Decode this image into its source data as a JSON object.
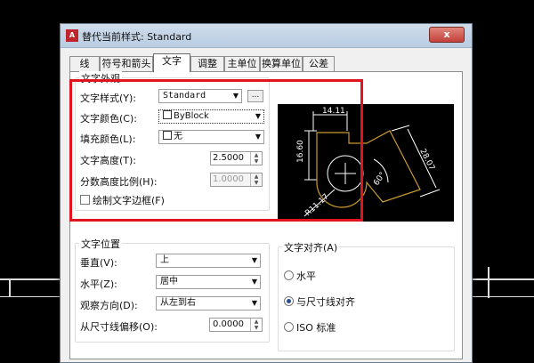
{
  "dialog": {
    "title": "替代当前样式: Standard",
    "app_icon_text": "A",
    "close_symbol": "x"
  },
  "tabs": [
    {
      "label": "线"
    },
    {
      "label": "符号和箭头"
    },
    {
      "label": "文字",
      "active": true
    },
    {
      "label": "调整"
    },
    {
      "label": "主单位"
    },
    {
      "label": "换算单位"
    },
    {
      "label": "公差"
    }
  ],
  "text_appearance": {
    "group_title": "文字外观",
    "style_label": "文字样式(Y):",
    "style_value": "Standard",
    "style_button": "...",
    "color_label": "文字颜色(C):",
    "color_value": "ByBlock",
    "fill_label": "填充颜色(L):",
    "fill_value": "无",
    "height_label": "文字高度(T):",
    "height_value": "2.5000",
    "fraction_label": "分数高度比例(H):",
    "fraction_value": "1.0000",
    "frame_label": "绘制文字边框(F)"
  },
  "text_placement": {
    "group_title": "文字位置",
    "vertical_label": "垂直(V):",
    "vertical_value": "上",
    "horizontal_label": "水平(Z):",
    "horizontal_value": "居中",
    "view_label": "观察方向(D):",
    "view_value": "从左到右",
    "offset_label": "从尺寸线偏移(O):",
    "offset_value": "0.0000"
  },
  "text_alignment": {
    "group_title": "文字对齐(A)",
    "options": [
      {
        "label": "水平",
        "checked": false
      },
      {
        "label": "与尺寸线对齐",
        "checked": true
      },
      {
        "label": "ISO 标准",
        "checked": false
      }
    ]
  },
  "preview": {
    "dim_top": "14.11",
    "dim_left": "16.60",
    "dim_right": "28.07",
    "dim_angle": "60°",
    "dim_radius": "R11.17"
  },
  "colors": {
    "highlight": "#e0141e",
    "preview_bg": "#000000",
    "preview_lines": "#ffffff",
    "preview_shape": "#c99a2e"
  }
}
